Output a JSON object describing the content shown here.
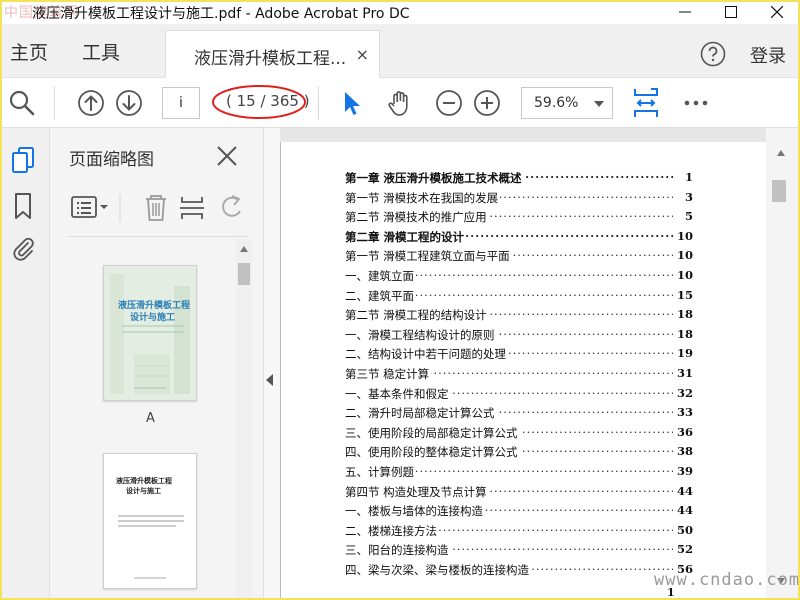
{
  "titlebar": {
    "watermark": "中国建筑网",
    "title": "液压滑升模板工程设计与施工.pdf - Adobe Acrobat Pro DC"
  },
  "menubar": {
    "home": "主页",
    "tools": "工具",
    "tab_label": "液压滑升模板工程...",
    "tab_close": "×",
    "login": "登录"
  },
  "toolbar": {
    "page_input": "i",
    "page_total": "( 15 / 365 )",
    "zoom": "59.6%"
  },
  "panel": {
    "title": "页面缩略图",
    "thumb1": {
      "title_line1": "液压滑升模板工程",
      "title_line2": "设计与施工",
      "label": "A"
    },
    "thumb2": {
      "title_line1": "液压滑升模板工程",
      "title_line2": "设计与施工"
    }
  },
  "toc": [
    {
      "text": "第一章   液压滑升模板施工技术概述",
      "page": "1",
      "bold": true
    },
    {
      "text": "第一节   滑模技术在我国的发展",
      "page": "3",
      "bold": false
    },
    {
      "text": "第二节   滑模技术的推广应用",
      "page": "5",
      "bold": false
    },
    {
      "text": "第二章   滑模工程的设计",
      "page": "10",
      "bold": true
    },
    {
      "text": "第一节   滑模工程建筑立面与平面",
      "page": "10",
      "bold": false
    },
    {
      "text": "一、建筑立面",
      "page": "10",
      "bold": false
    },
    {
      "text": "二、建筑平面",
      "page": "15",
      "bold": false
    },
    {
      "text": "第二节   滑模工程的结构设计",
      "page": "18",
      "bold": false
    },
    {
      "text": "一、滑模工程结构设计的原则",
      "page": "18",
      "bold": false
    },
    {
      "text": "二、结构设计中若干问题的处理",
      "page": "19",
      "bold": false
    },
    {
      "text": "第三节   稳定计算",
      "page": "31",
      "bold": false
    },
    {
      "text": "一、基本条件和假定",
      "page": "32",
      "bold": false
    },
    {
      "text": "二、滑升时局部稳定计算公式",
      "page": "33",
      "bold": false
    },
    {
      "text": "三、使用阶段的局部稳定计算公式",
      "page": "36",
      "bold": false
    },
    {
      "text": "四、使用阶段的整体稳定计算公式",
      "page": "38",
      "bold": false
    },
    {
      "text": "五、计算例题",
      "page": "39",
      "bold": false
    },
    {
      "text": "第四节   构造处理及节点计算",
      "page": "44",
      "bold": false
    },
    {
      "text": "一、楼板与墙体的连接构造",
      "page": "44",
      "bold": false
    },
    {
      "text": "二、楼梯连接方法",
      "page": "50",
      "bold": false
    },
    {
      "text": "三、阳台的连接构造",
      "page": "52",
      "bold": false
    },
    {
      "text": "四、梁与次梁、梁与楼板的连接构造",
      "page": "56",
      "bold": false
    }
  ],
  "page_footer": "1",
  "bottom_watermark": "www.cndao.com",
  "colors": {
    "accent": "#1473e6",
    "highlight_oval": "#e0201c",
    "frame": "#f4e35a"
  }
}
